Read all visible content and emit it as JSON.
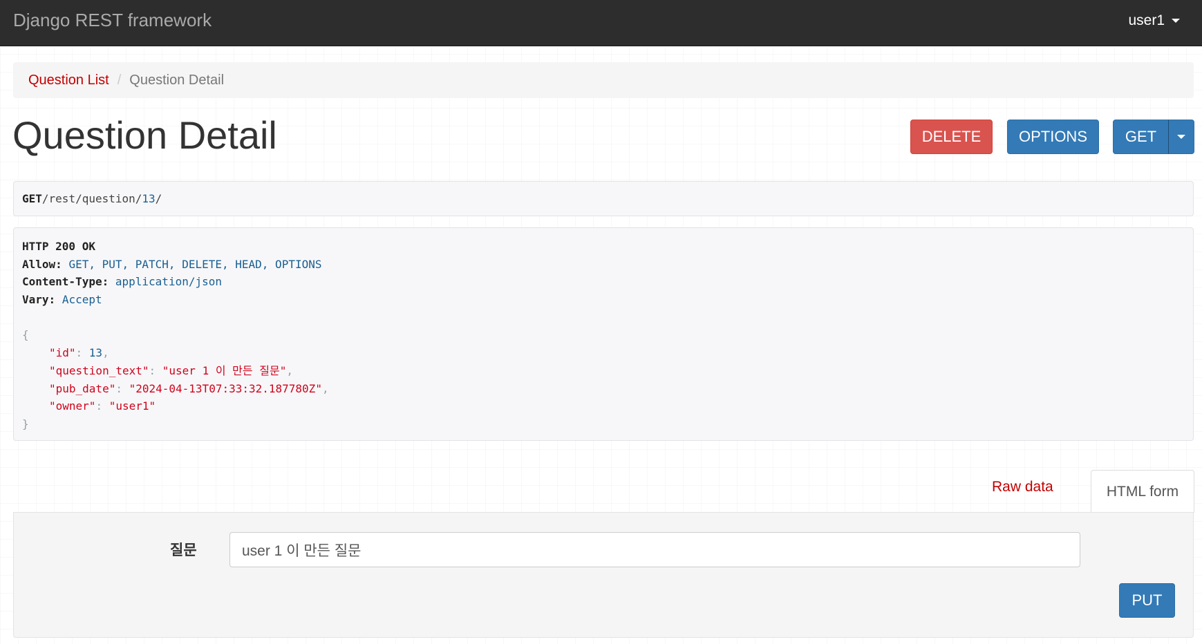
{
  "navbar": {
    "brand": "Django REST framework",
    "user": "user1"
  },
  "breadcrumb": {
    "link": "Question List",
    "separator": "/",
    "current": "Question Detail"
  },
  "page_title": "Question Detail",
  "buttons": {
    "delete": "DELETE",
    "options": "OPTIONS",
    "get": "GET",
    "put": "PUT"
  },
  "request": {
    "method": "GET",
    "path_prefix": "/rest/question/",
    "path_id": "13",
    "path_suffix": "/"
  },
  "response": {
    "status": "HTTP 200 OK",
    "headers": [
      {
        "key": "Allow:",
        "value": "GET, PUT, PATCH, DELETE, HEAD, OPTIONS"
      },
      {
        "key": "Content-Type:",
        "value": "application/json"
      },
      {
        "key": "Vary:",
        "value": "Accept"
      }
    ],
    "body": {
      "open": "{",
      "close": "}",
      "fields": [
        {
          "key": "\"id\"",
          "value": "13",
          "kind": "num",
          "comma": ","
        },
        {
          "key": "\"question_text\"",
          "value": "\"user 1 이 만든 질문\"",
          "kind": "str",
          "comma": ","
        },
        {
          "key": "\"pub_date\"",
          "value": "\"2024-04-13T07:33:32.187780Z\"",
          "kind": "str",
          "comma": ","
        },
        {
          "key": "\"owner\"",
          "value": "\"user1\"",
          "kind": "str",
          "comma": ""
        }
      ]
    }
  },
  "tabs": {
    "raw": "Raw data",
    "html": "HTML form"
  },
  "form": {
    "label": "질문",
    "value": "user 1 이 만든 질문"
  },
  "colors": {
    "navbar": "#2d2d2d",
    "link": "#c20000",
    "danger": "#d9534f",
    "primary": "#337ab7",
    "json_string": "#d0021b",
    "json_number": "#195f91"
  }
}
